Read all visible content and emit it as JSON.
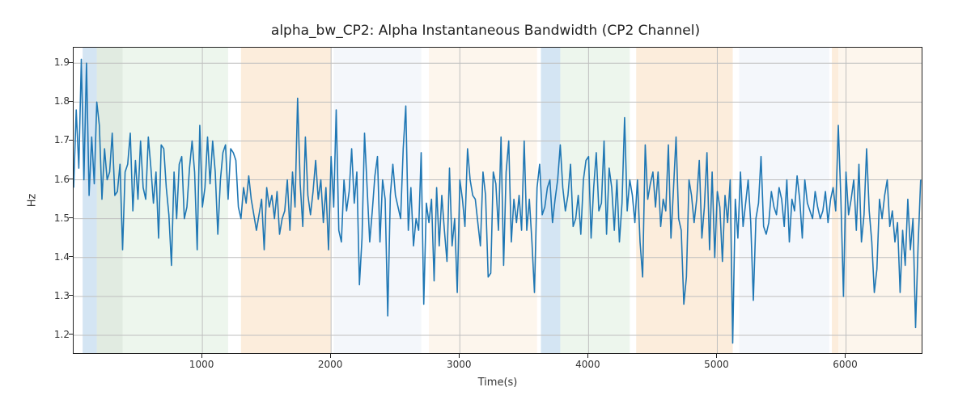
{
  "chart_data": {
    "type": "line",
    "title": "alpha_bw_CP2: Alpha Instantaneous Bandwidth (CP2 Channel)",
    "xlabel": "Time(s)",
    "ylabel": "Hz",
    "xlim": [
      0,
      6600
    ],
    "ylim": [
      1.15,
      1.94
    ],
    "xticks": [
      1000,
      2000,
      3000,
      4000,
      5000,
      6000
    ],
    "yticks": [
      1.2,
      1.3,
      1.4,
      1.5,
      1.6,
      1.7,
      1.8,
      1.9
    ],
    "grid": true,
    "background_bands": [
      {
        "x0": 70,
        "x1": 180,
        "color": "#6fa8d6"
      },
      {
        "x0": 180,
        "x1": 380,
        "color": "#9cbe9c"
      },
      {
        "x0": 380,
        "x1": 1200,
        "color": "#c4e0c4"
      },
      {
        "x0": 1300,
        "x1": 2000,
        "color": "#f5c48b"
      },
      {
        "x0": 2020,
        "x1": 2700,
        "color": "#d9e6f2"
      },
      {
        "x0": 2760,
        "x1": 3600,
        "color": "#f7e0c2"
      },
      {
        "x0": 3630,
        "x1": 3780,
        "color": "#6fa8d6"
      },
      {
        "x0": 3780,
        "x1": 4320,
        "color": "#c4e0c4"
      },
      {
        "x0": 4370,
        "x1": 5120,
        "color": "#f5c48b"
      },
      {
        "x0": 5170,
        "x1": 5870,
        "color": "#d9e6f2"
      },
      {
        "x0": 5890,
        "x1": 5940,
        "color": "#f5c48b"
      },
      {
        "x0": 5940,
        "x1": 6600,
        "color": "#f7e0c2"
      }
    ],
    "series": [
      {
        "name": "alpha_bw_CP2",
        "x_start": 0,
        "x_step": 20,
        "y": [
          1.58,
          1.78,
          1.63,
          1.91,
          1.6,
          1.9,
          1.56,
          1.71,
          1.59,
          1.8,
          1.74,
          1.55,
          1.68,
          1.6,
          1.62,
          1.72,
          1.56,
          1.57,
          1.64,
          1.42,
          1.62,
          1.64,
          1.72,
          1.52,
          1.65,
          1.55,
          1.7,
          1.58,
          1.55,
          1.71,
          1.63,
          1.54,
          1.62,
          1.45,
          1.69,
          1.68,
          1.58,
          1.51,
          1.38,
          1.62,
          1.5,
          1.64,
          1.66,
          1.5,
          1.53,
          1.63,
          1.7,
          1.62,
          1.42,
          1.74,
          1.53,
          1.58,
          1.71,
          1.59,
          1.7,
          1.62,
          1.46,
          1.6,
          1.67,
          1.69,
          1.55,
          1.68,
          1.67,
          1.65,
          1.53,
          1.5,
          1.58,
          1.54,
          1.61,
          1.55,
          1.51,
          1.47,
          1.51,
          1.55,
          1.42,
          1.58,
          1.53,
          1.56,
          1.5,
          1.57,
          1.46,
          1.5,
          1.52,
          1.6,
          1.47,
          1.62,
          1.53,
          1.81,
          1.59,
          1.48,
          1.71,
          1.56,
          1.51,
          1.57,
          1.65,
          1.55,
          1.6,
          1.49,
          1.58,
          1.42,
          1.66,
          1.53,
          1.78,
          1.47,
          1.44,
          1.6,
          1.52,
          1.57,
          1.68,
          1.54,
          1.62,
          1.33,
          1.45,
          1.72,
          1.58,
          1.44,
          1.52,
          1.61,
          1.66,
          1.44,
          1.6,
          1.55,
          1.25,
          1.56,
          1.64,
          1.56,
          1.53,
          1.5,
          1.68,
          1.79,
          1.47,
          1.58,
          1.43,
          1.5,
          1.47,
          1.67,
          1.28,
          1.54,
          1.49,
          1.55,
          1.34,
          1.58,
          1.43,
          1.56,
          1.47,
          1.39,
          1.63,
          1.43,
          1.5,
          1.31,
          1.6,
          1.55,
          1.48,
          1.68,
          1.6,
          1.56,
          1.55,
          1.49,
          1.43,
          1.62,
          1.56,
          1.35,
          1.36,
          1.62,
          1.59,
          1.47,
          1.71,
          1.38,
          1.62,
          1.7,
          1.44,
          1.55,
          1.49,
          1.56,
          1.47,
          1.7,
          1.47,
          1.55,
          1.44,
          1.31,
          1.58,
          1.64,
          1.51,
          1.53,
          1.58,
          1.6,
          1.49,
          1.55,
          1.6,
          1.69,
          1.58,
          1.52,
          1.56,
          1.64,
          1.48,
          1.5,
          1.56,
          1.46,
          1.6,
          1.65,
          1.66,
          1.45,
          1.58,
          1.67,
          1.52,
          1.54,
          1.7,
          1.46,
          1.63,
          1.58,
          1.47,
          1.6,
          1.44,
          1.54,
          1.76,
          1.52,
          1.6,
          1.56,
          1.49,
          1.6,
          1.44,
          1.35,
          1.69,
          1.55,
          1.59,
          1.62,
          1.53,
          1.62,
          1.48,
          1.55,
          1.52,
          1.69,
          1.45,
          1.58,
          1.71,
          1.5,
          1.47,
          1.28,
          1.35,
          1.6,
          1.56,
          1.49,
          1.55,
          1.65,
          1.45,
          1.53,
          1.67,
          1.42,
          1.62,
          1.4,
          1.57,
          1.53,
          1.39,
          1.56,
          1.49,
          1.6,
          1.18,
          1.55,
          1.45,
          1.62,
          1.48,
          1.54,
          1.6,
          1.49,
          1.29,
          1.5,
          1.54,
          1.66,
          1.48,
          1.46,
          1.49,
          1.57,
          1.53,
          1.51,
          1.58,
          1.55,
          1.48,
          1.6,
          1.44,
          1.55,
          1.52,
          1.61,
          1.55,
          1.45,
          1.6,
          1.54,
          1.52,
          1.5,
          1.57,
          1.53,
          1.5,
          1.52,
          1.57,
          1.49,
          1.55,
          1.58,
          1.52,
          1.74,
          1.55,
          1.3,
          1.62,
          1.51,
          1.55,
          1.6,
          1.47,
          1.64,
          1.44,
          1.51,
          1.68,
          1.52,
          1.44,
          1.31,
          1.37,
          1.55,
          1.5,
          1.56,
          1.6,
          1.48,
          1.52,
          1.44,
          1.49,
          1.31,
          1.47,
          1.38,
          1.55,
          1.42,
          1.5,
          1.22,
          1.43,
          1.6
        ]
      }
    ]
  }
}
